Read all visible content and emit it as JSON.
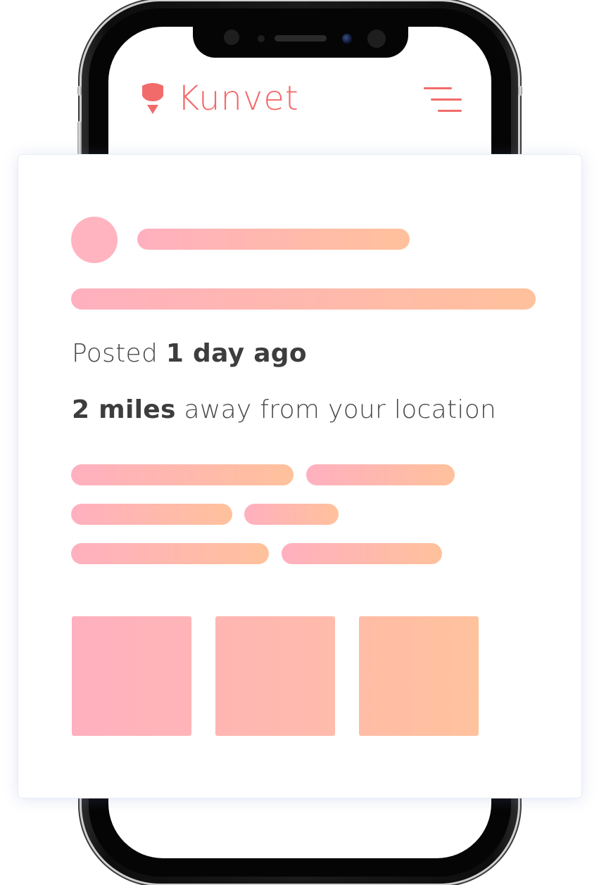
{
  "app": {
    "brand_name": "Kunvet",
    "brand_color": "#f26b6b",
    "logo_icon": "kunvet-logo-icon",
    "menu_icon": "hamburger-menu-icon"
  },
  "post": {
    "posted_prefix": "Posted",
    "posted_time": "1 day ago",
    "distance_value": "2 miles",
    "distance_suffix": "away from your location"
  },
  "placeholder_gradient": {
    "start": "#ffb0bf",
    "end": "#ffc19c"
  },
  "card": {
    "background": "#ffffff",
    "shadow_color": "#e8ebf6"
  }
}
